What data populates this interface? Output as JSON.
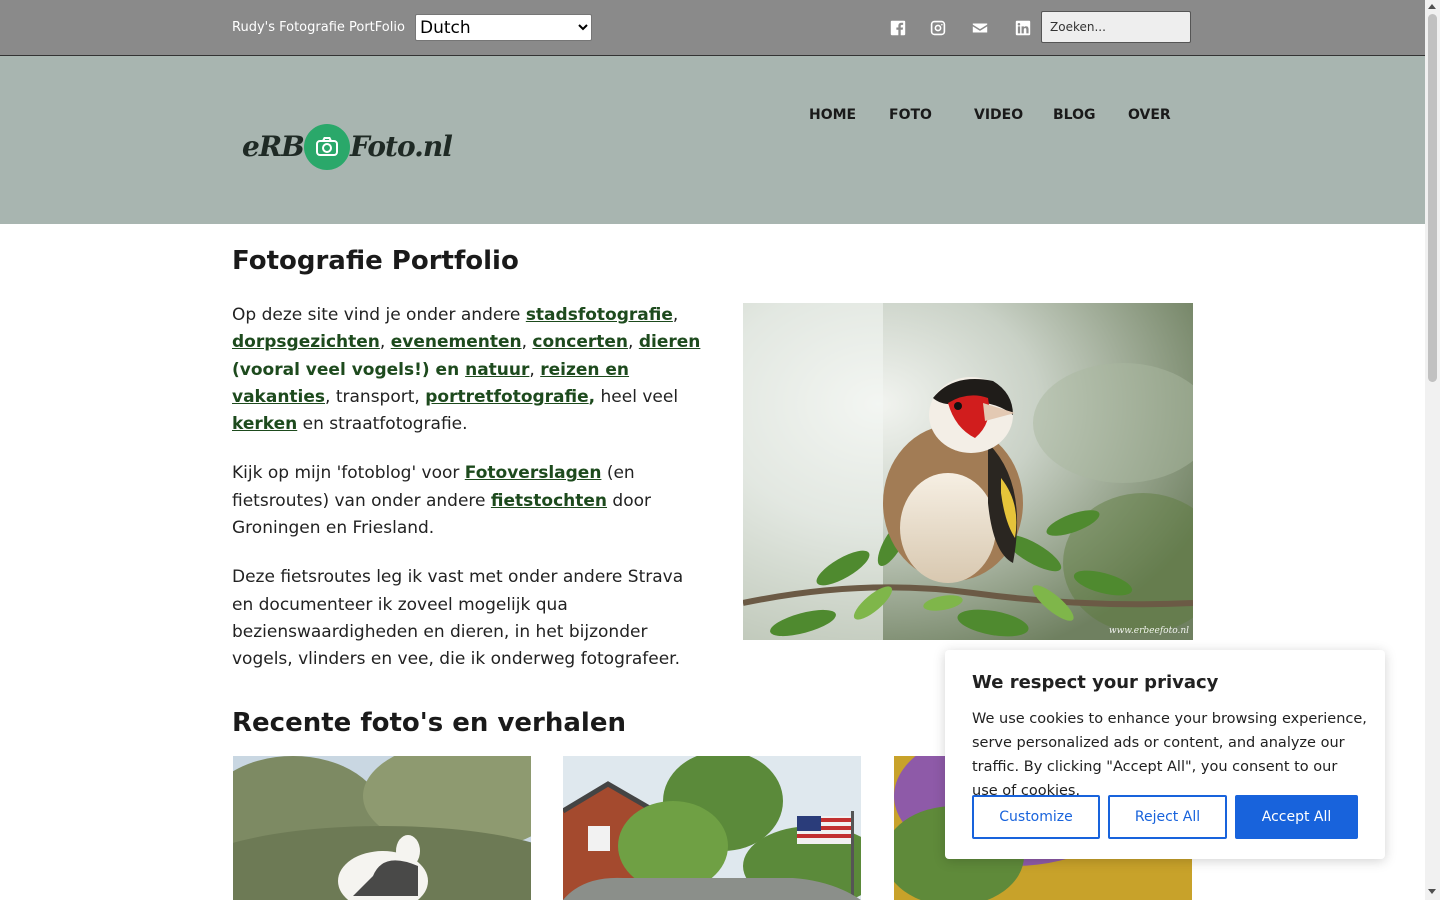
{
  "topbar": {
    "site_name": "Rudy's Fotografie PortFolio",
    "language": {
      "selected": "Dutch",
      "options": [
        "Dutch"
      ]
    },
    "social_icons": [
      "facebook-icon",
      "instagram-icon",
      "envelope-icon",
      "linkedin-icon"
    ],
    "search_placeholder": "Zoeken..."
  },
  "header": {
    "logo": {
      "left": "eRBee",
      "right": "Foto.nl"
    },
    "nav": [
      "HOME",
      "FOTO",
      "VIDEO",
      "BLOG",
      "OVER"
    ]
  },
  "main": {
    "title": "Fotografie Portfolio",
    "p1": {
      "t1": "Op deze site vind je onder andere ",
      "l1": "stadsfotografie",
      "t2": ", ",
      "l2": "dorpsgezichten",
      "t3": ", ",
      "l3": "evenementen",
      "t4": ", ",
      "l4": "concerten",
      "t5": ", ",
      "l5": "dieren",
      "b1": " (vooral veel vogels!) en ",
      "l6": "natuur",
      "t6": ", ",
      "l7": "reizen en vakanties",
      "t7": ", transport, ",
      "l8": "portretfotografie",
      "b2": ",",
      "t8": " heel veel ",
      "l9": "kerken",
      "t9": " en straatfotografie."
    },
    "p2": {
      "t1": "Kijk op mijn 'fotoblog' voor ",
      "l1": "Fotoverslagen",
      "t2": " (en fietsroutes) van onder andere ",
      "l2": "fietstochten",
      "t3": " door Groningen en Friesland."
    },
    "p3": "Deze fietsroutes leg ik vast met onder andere Strava en documenteer ik zoveel mogelijk qua bezienswaardigheden en dieren, in het bijzonder vogels, vlinders en vee, die ik onderweg fotografeer.",
    "hero_watermark": "www.erbeefoto.nl",
    "section_title": "Recente foto's en verhalen"
  },
  "cookie": {
    "title": "We respect your privacy",
    "text": "We use cookies to enhance your browsing experience, serve personalized ads or content, and analyze our traffic. By clicking \"Accept All\", you consent to our use of cookies.",
    "customize": "Customize",
    "reject": "Reject All",
    "accept": "Accept All"
  },
  "colors": {
    "topbar": "#8a8a8a",
    "header": "#a8b5b0",
    "link_green": "#1d4a1d",
    "logo_green": "#2aa86a",
    "cookie_blue": "#1863dc"
  }
}
